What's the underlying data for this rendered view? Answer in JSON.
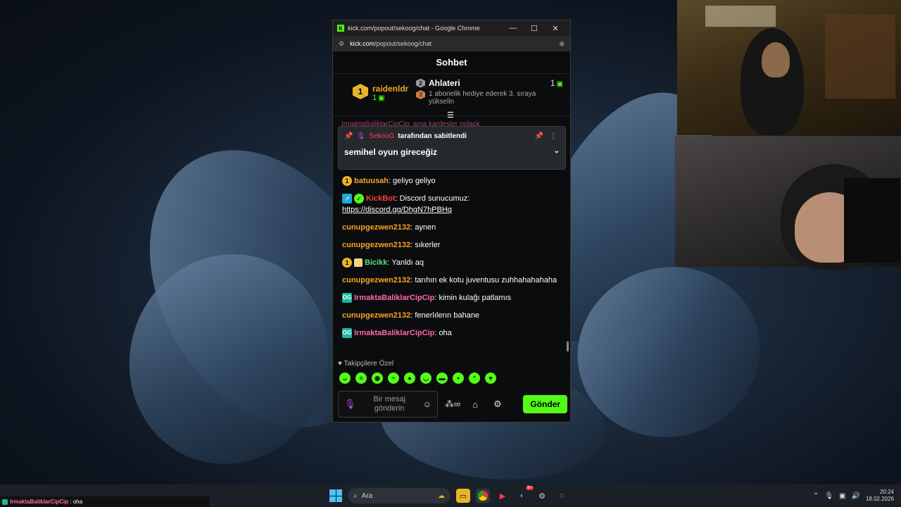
{
  "window": {
    "title": "kick.com/popout/sekoog/chat - Google Chrome",
    "url_host": "kick.com",
    "url_path": "/popout/sekoog/chat",
    "minimize": "—",
    "maximize": "☐",
    "close": "✕"
  },
  "chat": {
    "header": "Sohbet",
    "leaderboard": {
      "first_rank": "1",
      "first_name": "raidenldr",
      "first_count": "1",
      "second_rank": "2",
      "second_name": "Ahlateri",
      "second_count": "1",
      "third_rank": "3",
      "third_text": "1 abonelik hediye ederek 3. sıraya yükselin"
    },
    "peek_text": "IrmaktaBaliklarCipCip: ama kardesler nolack",
    "pinned": {
      "author": "SekooG",
      "by_text": "tarafından sabitlendi",
      "message": "semihel oyun gireceğiz"
    },
    "messages": [
      {
        "user": "batuusah",
        "text": ": geliyo geliyo"
      },
      {
        "user": "KickBot",
        "text": ": Discord sunucumuz:",
        "link": "https://discord.gg/DhgN7hPBHq"
      },
      {
        "user": "cunupgezwen2132",
        "text": ": aynen"
      },
      {
        "user": "cunupgezwen2132",
        "text": ": sıkerler"
      },
      {
        "user": "Bicikk",
        "text": ": Yanldı aq"
      },
      {
        "user": "cunupgezwen2132",
        "text": ": tarıhın ek kotu juventusu zuhhahahahaha"
      },
      {
        "user": "IrmaktaBaliklarCipCip",
        "text": ": kimin kulağı patlamıs"
      },
      {
        "user": "cunupgezwen2132",
        "text": ": fenerlılerın bahane"
      },
      {
        "user": "IrmaktaBaliklarCipCip",
        "text": ": oha"
      }
    ],
    "emote_label": "Takipçilere Özel",
    "composer": {
      "placeholder": "Bir mesaj gönderin",
      "send": "Gönder"
    }
  },
  "taskbar": {
    "chatter_name": "IrmaktaBaliklarCipCip",
    "chatter_text": ": oha",
    "search_placeholder": "Ara",
    "discord_badge": "9+",
    "time": "20:24",
    "date": "18.02.2026"
  },
  "colors": {
    "kick_green": "#53fc18",
    "gold_user": "#f5a623",
    "pink_user": "#ff6aa8"
  }
}
